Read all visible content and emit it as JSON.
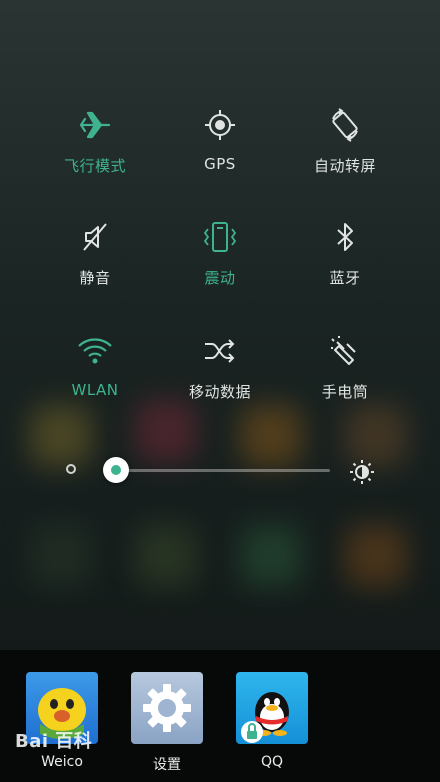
{
  "toggles": [
    {
      "label": "飞行模式",
      "icon": "airplane-icon",
      "on": true
    },
    {
      "label": "GPS",
      "icon": "gps-icon",
      "on": false
    },
    {
      "label": "自动转屏",
      "icon": "auto-rotate-icon",
      "on": false
    },
    {
      "label": "静音",
      "icon": "mute-icon",
      "on": false
    },
    {
      "label": "震动",
      "icon": "vibrate-icon",
      "on": true
    },
    {
      "label": "蓝牙",
      "icon": "bluetooth-icon",
      "on": false
    },
    {
      "label": "WLAN",
      "icon": "wifi-icon",
      "on": true
    },
    {
      "label": "移动数据",
      "icon": "mobile-data-icon",
      "on": false
    },
    {
      "label": "手电筒",
      "icon": "flashlight-icon",
      "on": false
    }
  ],
  "brightness": {
    "level": 0.02
  },
  "dock": {
    "apps": [
      {
        "name": "Weico",
        "icon": "weico-app-icon"
      },
      {
        "name": "设置",
        "icon": "settings-app-icon"
      },
      {
        "name": "QQ",
        "icon": "qq-app-icon"
      }
    ]
  },
  "watermark": "Bai 百科",
  "colors": {
    "active": "#3fb28f",
    "inactive": "#dfe3e2",
    "dock_bg": "#070909"
  }
}
